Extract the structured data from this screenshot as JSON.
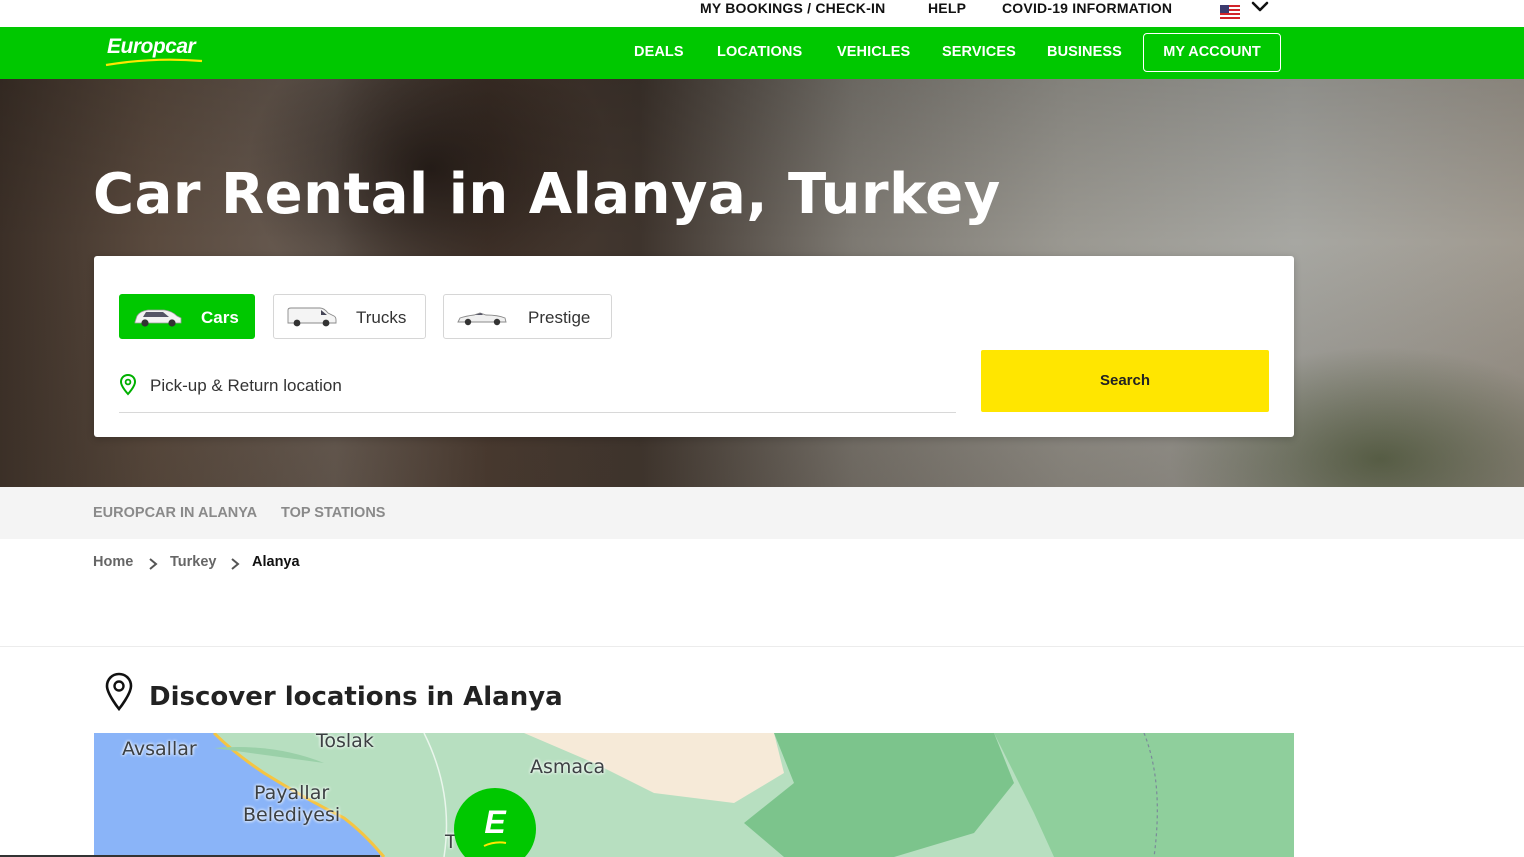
{
  "utility_nav": {
    "bookings": "MY BOOKINGS / CHECK-IN",
    "help": "HELP",
    "covid": "COVID-19 INFORMATION",
    "language_icon": "us-flag-icon",
    "language_dropdown_icon": "chevron-down-icon"
  },
  "brand": {
    "logo_text": "Europcar",
    "primary_color": "#00c800",
    "accent_color": "#ffe600"
  },
  "main_nav": {
    "items": [
      {
        "label": "DEALS"
      },
      {
        "label": "LOCATIONS"
      },
      {
        "label": "VEHICLES"
      },
      {
        "label": "SERVICES"
      },
      {
        "label": "BUSINESS"
      }
    ],
    "account_label": "MY ACCOUNT"
  },
  "hero": {
    "title": "Car Rental in Alanya, Turkey"
  },
  "search_widget": {
    "vehicle_tabs": [
      {
        "label": "Cars",
        "icon": "car-icon",
        "active": true
      },
      {
        "label": "Trucks",
        "icon": "van-icon",
        "active": false
      },
      {
        "label": "Prestige",
        "icon": "convertible-icon",
        "active": false
      }
    ],
    "location_placeholder": "Pick-up & Return location",
    "location_icon": "location-pin-icon",
    "search_label": "Search"
  },
  "anchor_nav": {
    "items": [
      {
        "label": "EUROPCAR IN ALANYA"
      },
      {
        "label": "TOP STATIONS"
      }
    ]
  },
  "breadcrumb": {
    "items": [
      {
        "label": "Home"
      },
      {
        "label": "Turkey"
      },
      {
        "label": "Alanya"
      }
    ],
    "separator_icon": "chevron-right-icon"
  },
  "locations_section": {
    "icon": "location-pin-icon",
    "title": "Discover locations in Alanya",
    "map": {
      "places": [
        "Avsallar",
        "Toslak",
        "Asmaca",
        "Payallar",
        "Belediyesi",
        "T"
      ],
      "marker_letter": "E"
    }
  }
}
